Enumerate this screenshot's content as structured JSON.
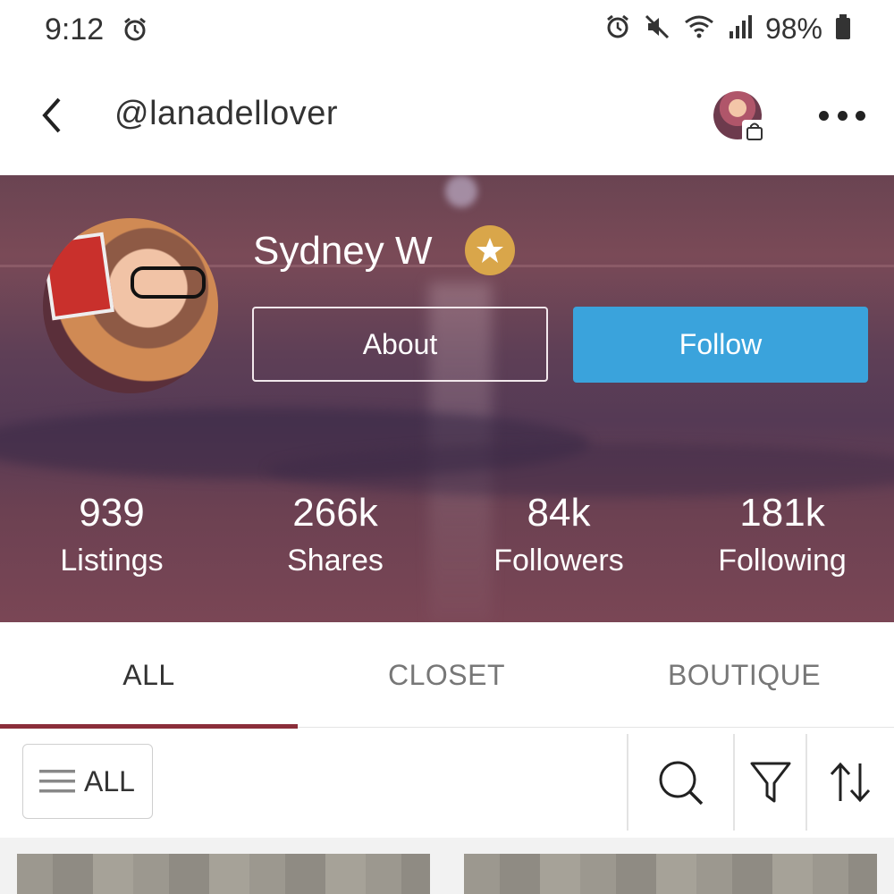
{
  "status_bar": {
    "time": "9:12",
    "battery": "98%",
    "icons": [
      "alarm-icon",
      "mute-icon",
      "wifi-icon",
      "signal-icon",
      "battery-icon"
    ]
  },
  "header": {
    "title": "@lanadellover",
    "icons": [
      "back-icon",
      "closet-avatar",
      "shopping-bag-icon",
      "more-icon"
    ]
  },
  "profile": {
    "name": "Sydney W",
    "badge_icon": "star-icon",
    "about_label": "About",
    "follow_label": "Follow",
    "stats": [
      {
        "value": "939",
        "label": "Listings"
      },
      {
        "value": "266k",
        "label": "Shares"
      },
      {
        "value": "84k",
        "label": "Followers"
      },
      {
        "value": "181k",
        "label": "Following"
      }
    ]
  },
  "tabs": [
    {
      "label": "ALL",
      "active": true
    },
    {
      "label": "CLOSET",
      "active": false
    },
    {
      "label": "BOUTIQUE",
      "active": false
    }
  ],
  "filter_bar": {
    "all_label": "ALL",
    "icons": [
      "menu-icon",
      "search-icon",
      "filter-icon",
      "sort-icon"
    ]
  },
  "colors": {
    "accent": "#8b2e3a",
    "follow_button": "#3aa3dc",
    "star_badge": "#d9a64a"
  }
}
